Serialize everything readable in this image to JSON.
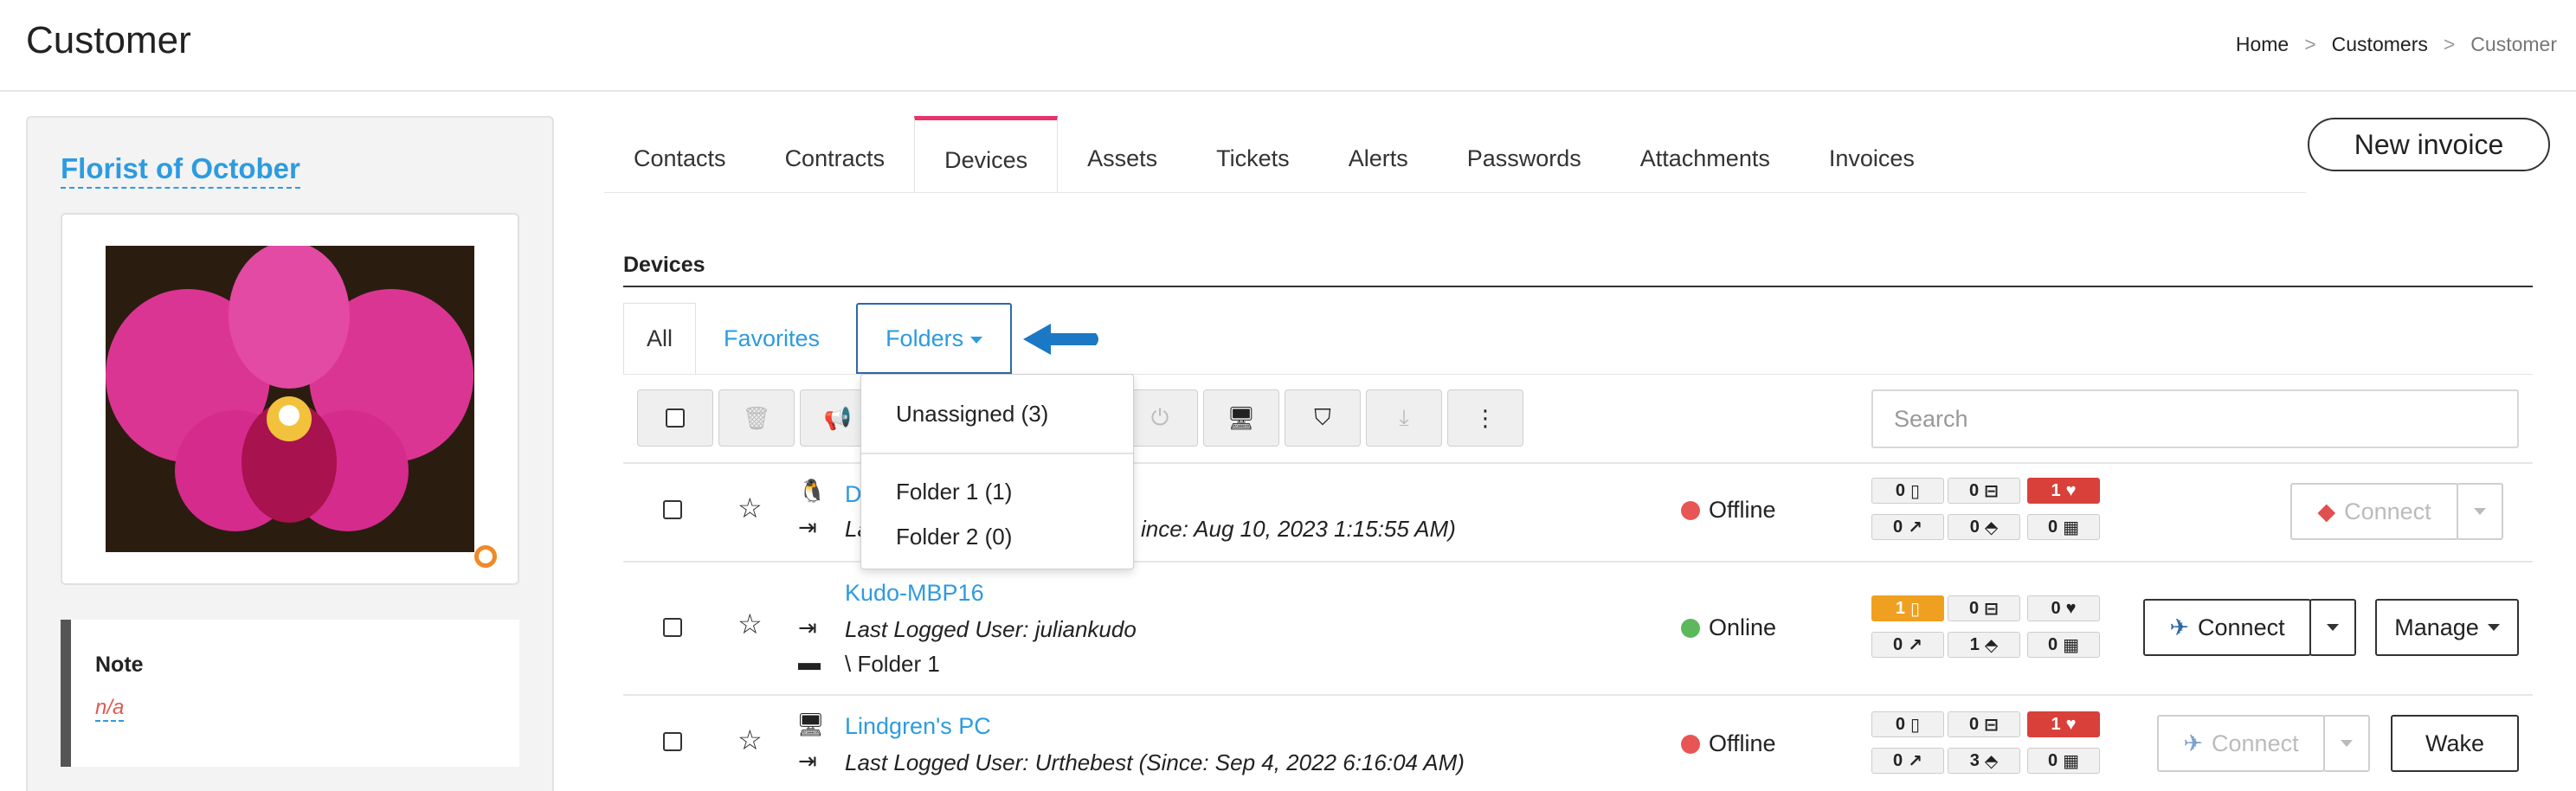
{
  "header": {
    "title": "Customer",
    "breadcrumb": {
      "home": "Home",
      "sep": ">",
      "customers": "Customers",
      "current": "Customer"
    }
  },
  "customer": {
    "name": "Florist of October"
  },
  "note": {
    "title": "Note",
    "value": "n/a"
  },
  "tabs": [
    "Contacts",
    "Contracts",
    "Devices",
    "Assets",
    "Tickets",
    "Alerts",
    "Passwords",
    "Attachments",
    "Invoices"
  ],
  "active_tab": "Devices",
  "new_invoice_label": "New invoice",
  "devices": {
    "heading": "Devices",
    "subtabs": {
      "all": "All",
      "favorites": "Favorites",
      "folders": "Folders"
    },
    "search_placeholder": "Search",
    "folders_menu": [
      "Unassigned (3)",
      "Folder 1 (1)",
      "Folder 2 (0)"
    ],
    "rows": [
      {
        "name": "D",
        "os_icon": "linux-icon",
        "info_visible": "ince: Aug 10, 2023 1:15:55 AM)",
        "info_prefix": "La",
        "status": "Offline",
        "status_color": "#e85555",
        "badges": [
          "0",
          "0",
          "1",
          "0",
          "0",
          "0"
        ],
        "connect_label": "Connect",
        "connect_disabled": true
      },
      {
        "name": "Kudo-MBP16",
        "os_icon": "apple-icon",
        "info": "Last Logged User: juliankudo",
        "folder": "\\ Folder 1",
        "status": "Online",
        "status_color": "#5cb85c",
        "badges": [
          "1",
          "0",
          "0",
          "0",
          "1",
          "0"
        ],
        "connect_label": "Connect",
        "manage_label": "Manage"
      },
      {
        "name": "Lindgren's PC",
        "os_icon": "desktop-icon",
        "info": "Last Logged User: Urthebest (Since: Sep 4, 2022 6:16:04 AM)",
        "status": "Offline",
        "status_color": "#e85555",
        "badges": [
          "0",
          "0",
          "1",
          "0",
          "3",
          "0"
        ],
        "connect_label": "Connect",
        "connect_disabled": true,
        "wake_label": "Wake"
      }
    ]
  },
  "colors": {
    "accent": "#2d9be0",
    "active_tab": "#e8336b",
    "danger": "#d9403a",
    "warning": "#f0a020"
  }
}
